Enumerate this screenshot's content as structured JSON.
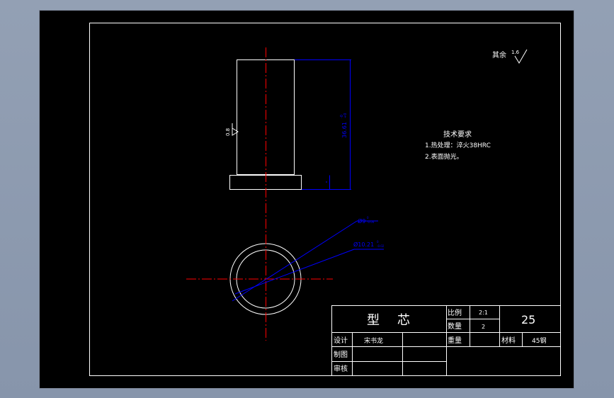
{
  "drawing": {
    "part_name_char1": "型",
    "part_name_char2": "芯",
    "surface_finish": {
      "rest_label": "其余",
      "rest_value": "1.6",
      "side_value": "0.8"
    },
    "dimensions": {
      "height": "36.61",
      "height_tol": "+0",
      "height_tol_lower": "-0",
      "dia_inner": "Ø9",
      "dia_inner_tol": "0",
      "dia_inner_tol_lower": "-0.04",
      "dia_outer": "Ø10.21",
      "dia_outer_tol": "0",
      "dia_outer_tol_lower": "-0.02"
    },
    "tech_req": {
      "title": "技术要求",
      "line1": "1.热处理：淬火38HRC",
      "line2": "2.表面抛光。"
    },
    "title_block": {
      "scale_label": "比例",
      "scale_value": "2:1",
      "qty_label": "数量",
      "qty_value": "2",
      "weight_label": "重量",
      "material_label": "材料",
      "material_value": "45钢",
      "sheet_no": "25",
      "design_label": "设计",
      "designer": "宋书龙",
      "drawn_label": "制图",
      "check_label": "审核"
    }
  },
  "colors": {
    "background": "#000000",
    "line": "#ffffff",
    "center_line": "#ff0000",
    "dimension": "#0000ff",
    "desktop": "#8f9cb0"
  }
}
